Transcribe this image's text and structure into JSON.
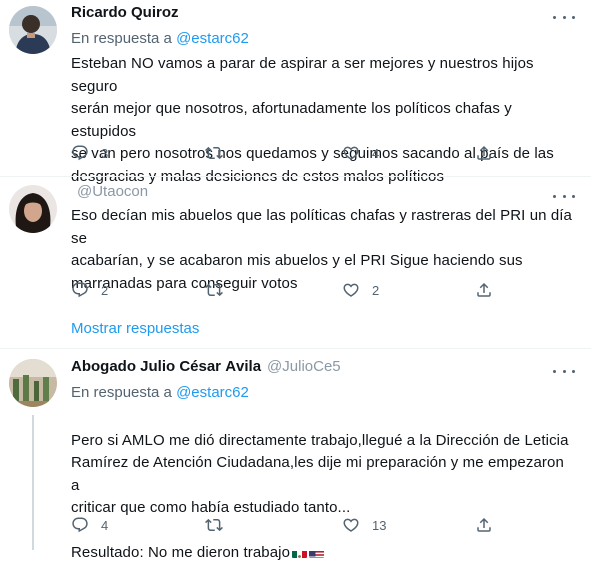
{
  "tweets": [
    {
      "name": "Ricardo Quiroz",
      "handle": "",
      "reply_prefix": "En respuesta a ",
      "reply_handle": "@estarc62",
      "text": "Esteban NO vamos a parar de aspirar a ser mejores y nuestros hijos seguro\nserán mejor que nosotros, afortunadamente los políticos chafas y estupidos\nse van pero nosotros nos quedamos y seguimos sacando al país de las\ndesgracias y malas desiciones de estos malos políticos",
      "replies": "3",
      "retweets": "",
      "likes": "4"
    },
    {
      "name": "",
      "handle": "@Utaocon",
      "reply_prefix": "",
      "reply_handle": "",
      "text": "Eso decían mis abuelos que las políticas chafas y rastreras del PRI un día se\nacabarían, y se acabaron mis abuelos y el PRI Sigue haciendo sus\nmarranadas para conseguir votos",
      "replies": "2",
      "retweets": "",
      "likes": "2"
    },
    {
      "name": "Abogado Julio César Ávila",
      "handle": "@JulioCe5",
      "reply_prefix": "En respuesta a ",
      "reply_handle": "@estarc62",
      "text": "Pero si AMLO me dió directamente trabajo,llegué a la Dirección de Leticia\nRamírez de Atención Ciudadana,les dije mi preparación y me empezaron a\ncriticar que como había estudiado tanto...\n\nResultado: No me dieron trabajo",
      "replies": "4",
      "retweets": "",
      "likes": "13"
    }
  ],
  "show_replies": "Mostrar respuestas",
  "colors": {
    "link": "#1d9bf0",
    "secondary": "#536471",
    "text": "#0f1419",
    "divider": "#eff3f4"
  },
  "icons": [
    "reply-icon",
    "retweet-icon",
    "like-icon",
    "share-icon",
    "more-icon"
  ]
}
